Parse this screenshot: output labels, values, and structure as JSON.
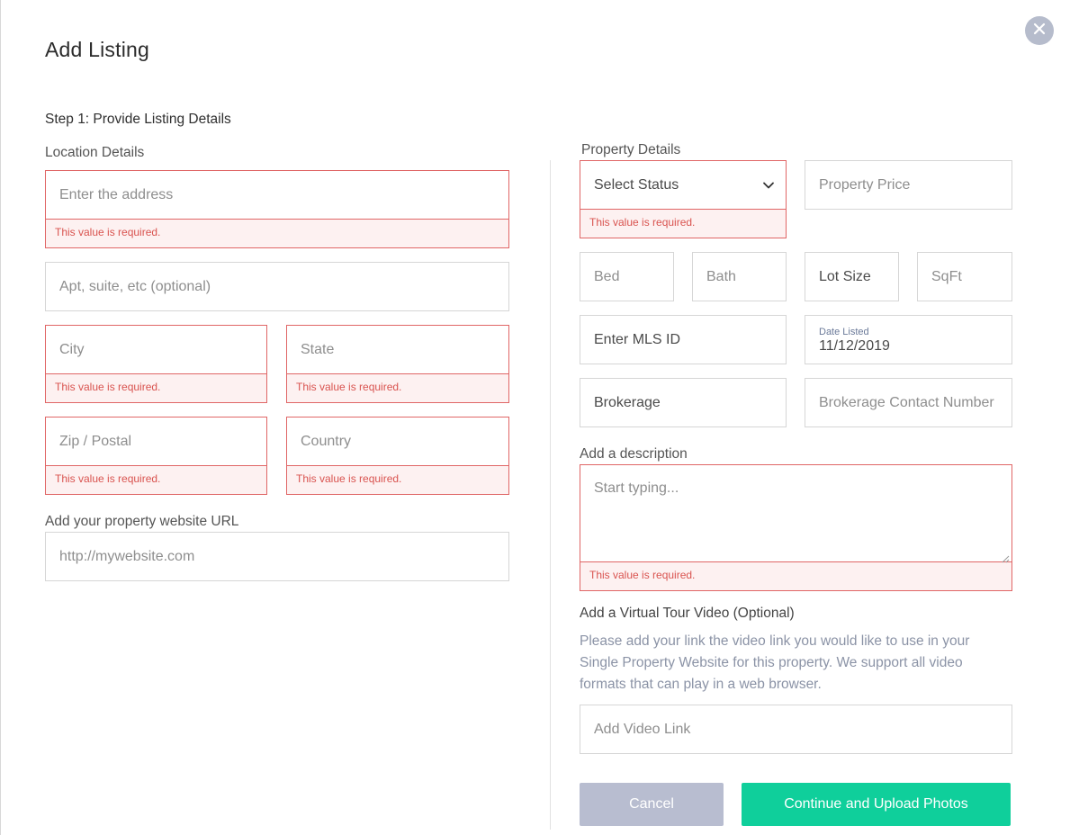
{
  "modal": {
    "title": "Add Listing",
    "step": "Step 1: Provide Listing Details"
  },
  "location": {
    "section_label": "Location Details",
    "address_placeholder": "Enter the address",
    "apt_placeholder": "Apt, suite, etc (optional)",
    "city_placeholder": "City",
    "state_placeholder": "State",
    "zip_placeholder": "Zip / Postal",
    "country_placeholder": "Country",
    "error_message": "This value is required."
  },
  "website": {
    "label": "Add your property website URL",
    "placeholder": "http://mywebsite.com"
  },
  "property": {
    "section_label": "Property Details",
    "status_value": "Select Status",
    "price_placeholder": "Property Price",
    "bed_placeholder": "Bed",
    "bath_placeholder": "Bath",
    "lot_size_value": "Lot Size",
    "sqft_placeholder": "SqFt",
    "mls_value": "Enter MLS ID",
    "date_label": "Date Listed",
    "date_value": "11/12/2019",
    "brokerage_value": "Brokerage",
    "brokerage_contact_placeholder": "Brokerage Contact Number"
  },
  "description": {
    "label": "Add a description",
    "placeholder": "Start typing..."
  },
  "video": {
    "label": "Add a Virtual Tour Video (Optional)",
    "help": "Please add your link the video link you would like to use in your Single Property Website for this property. We support all video formats that can play in a web browser.",
    "placeholder": "Add Video Link"
  },
  "actions": {
    "cancel_label": "Cancel",
    "continue_label": "Continue and Upload Photos"
  },
  "colors": {
    "accent_green": "#0fcf9b",
    "cancel_gray": "#b8bdd0",
    "error_red": "#e06666",
    "close_bg": "#b6bccc"
  },
  "icons": {
    "close": "close-icon",
    "dropdown": "chevron-down-icon",
    "resize": "resize-grip-icon"
  }
}
